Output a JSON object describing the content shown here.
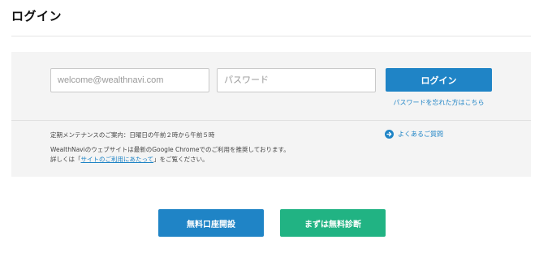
{
  "page": {
    "title": "ログイン"
  },
  "login": {
    "email_placeholder": "welcome@wealthnavi.com",
    "password_placeholder": "パスワード",
    "login_button": "ログイン",
    "forgot_link": "パスワードを忘れた方はこちら"
  },
  "notices": {
    "maintenance": "定期メンテナンスのご案内：日曜日の午前２時から午前５時",
    "chrome": "WealthNaviのウェブサイトは最新のGoogle Chromeでのご利用を推奨しております。",
    "detail_prefix": "詳しくは「",
    "detail_link": "サイトのご利用にあたって",
    "detail_suffix": "」をご覧ください。"
  },
  "faq": {
    "label": "よくあるご質問",
    "icon": "arrow-right-circle-icon"
  },
  "cta": {
    "open_account": "無料口座開設",
    "diagnosis": "まずは無料診断"
  },
  "colors": {
    "primary": "#1f84c6",
    "secondary": "#21b383",
    "panel": "#f4f4f4"
  }
}
